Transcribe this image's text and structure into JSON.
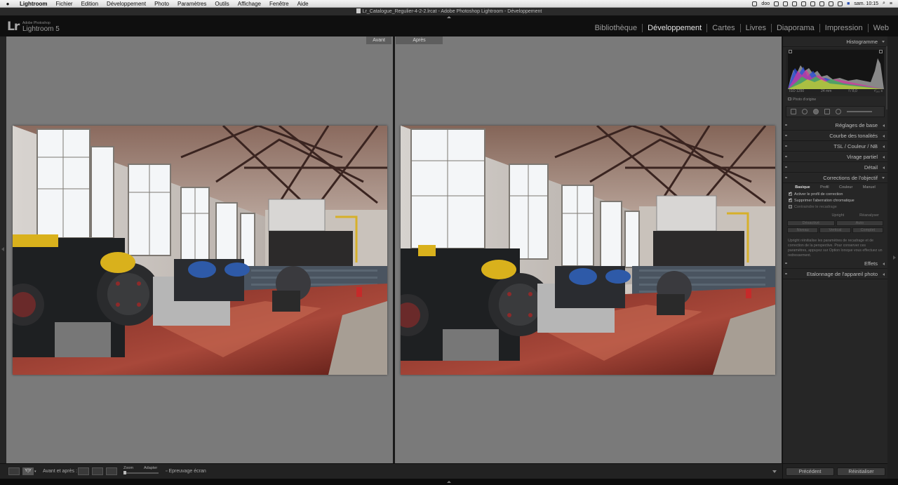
{
  "menubar": {
    "items": [
      "Lightroom",
      "Fichier",
      "Edition",
      "Développement",
      "Photo",
      "Paramètres",
      "Outils",
      "Affichage",
      "Fenêtre",
      "Aide"
    ],
    "user": "doo",
    "clock": "sam. 10:15"
  },
  "window": {
    "title": "Lr_Catalogue_Regulier-4-2-2.lrcat - Adobe Photoshop Lightroom - Développement"
  },
  "identity": {
    "brand_small": "Adobe Photoshop",
    "product": "Lightroom 5",
    "logo": "Lr"
  },
  "modules": [
    "Bibliothèque",
    "Développement",
    "Cartes",
    "Livres",
    "Diaporama",
    "Impression",
    "Web"
  ],
  "active_module": "Développement",
  "viewer": {
    "before_label": "Avant",
    "after_label": "Après"
  },
  "toolbar": {
    "view_mode_label": "Avant et après :",
    "yy_label": "Y|Y",
    "zoom_label": "Zoom",
    "fit_label": "Adapter",
    "softproof_label": "Epreuvage écran"
  },
  "right_panel": {
    "histogram_title": "Histogramme",
    "histo_meta": [
      "ISO 1250",
      "24 mm",
      "f / 8,0",
      "¹⁄₁₆₀ s"
    ],
    "photo_orig": "Photo d'origine",
    "sections": [
      "Réglages de base",
      "Courbe des tonalités",
      "TSL / Couleur / NB",
      "Virage partiel",
      "Détail",
      "Corrections de l'objectif"
    ],
    "lens_tabs": [
      "Basique",
      "Profil",
      "Couleur",
      "Manuel"
    ],
    "checks": [
      {
        "label": "Activer le profil de correction",
        "checked": true
      },
      {
        "label": "Supprimer l'aberration chromatique",
        "checked": true
      },
      {
        "label": "Contraindre le recadrage",
        "checked": false
      }
    ],
    "upright_label": "Upright",
    "reanalyze_label": "Réanalyser",
    "upright_buttons_1": [
      "Désactivé",
      "Auto"
    ],
    "upright_buttons_2": [
      "Niveau",
      "Vertical",
      "Complet"
    ],
    "help_text": "Upright réinitialise les paramètres de recadrage et de correction de la perspective. Pour conserver ces paramètres, appuyez sur Option lorsque vous effectuez un redressement.",
    "sections_after": [
      "Effets",
      "Etalonnage de l'appareil photo"
    ],
    "prev_button": "Précédent",
    "reset_button": "Réinitialiser"
  },
  "colors": {
    "panel_bg": "#262626",
    "viewer_bg": "#7a7a7a",
    "active_text": "#e6e6e6"
  }
}
